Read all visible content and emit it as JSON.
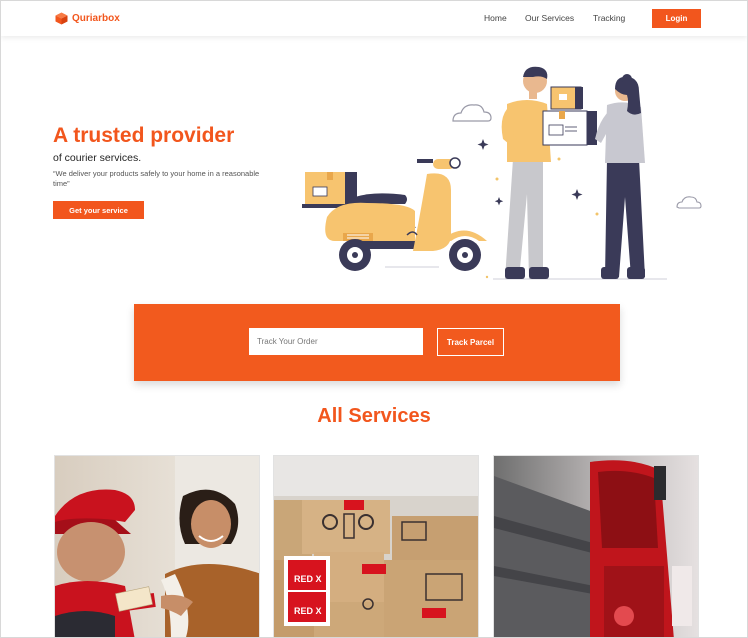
{
  "brand": {
    "name": "Quriarbox",
    "color": "#f2561d"
  },
  "nav": {
    "links": [
      "Home",
      "Our Services",
      "Tracking"
    ],
    "login": "Login"
  },
  "hero": {
    "title": "A trusted provider",
    "subtitle": "of courier services.",
    "quote": "“We deliver your products safely to your home in a reasonable time”",
    "cta": "Get your service"
  },
  "tracking": {
    "placeholder": "Track Your Order",
    "button": "Track Parcel"
  },
  "services": {
    "heading": "All Services"
  },
  "card_overlays": {
    "redx": "RED X"
  }
}
